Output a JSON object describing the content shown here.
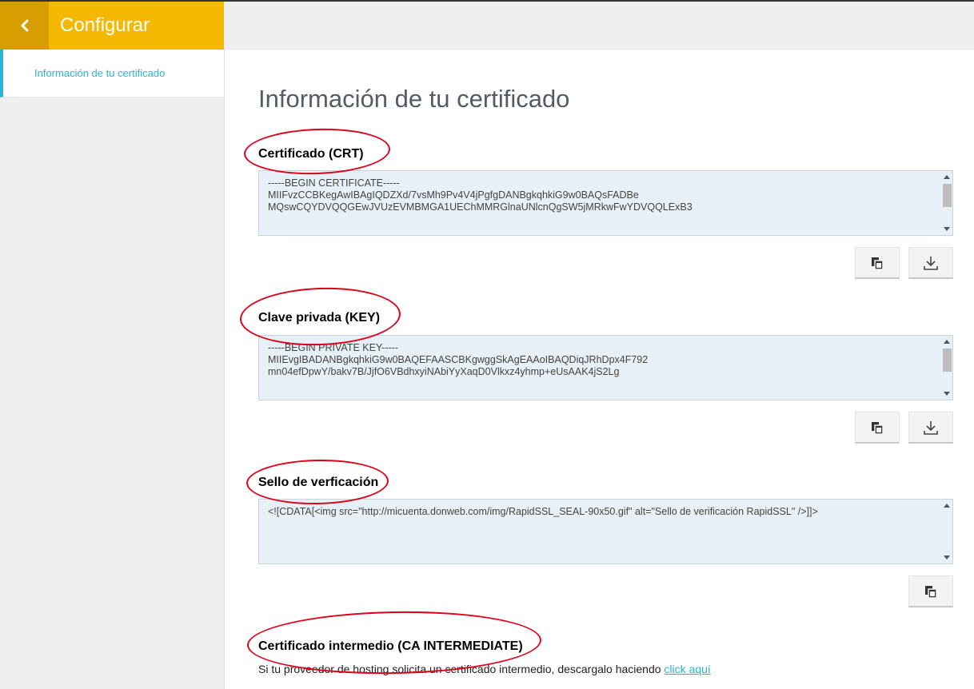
{
  "header": {
    "title": "Configurar",
    "back_icon": "chevron-left-icon"
  },
  "sidebar": {
    "items": [
      {
        "label": "Información de tu certificado",
        "active": true
      }
    ]
  },
  "page": {
    "title": "Información de tu certificado"
  },
  "sections": {
    "crt": {
      "heading": "Certificado (CRT)",
      "lines": [
        "-----BEGIN CERTIFICATE-----",
        "MIIFvzCCBKegAwIBAgIQDZXd/7vsMh9Pv4V4jPgfgDANBgkqhkiG9w0BAQsFADBe",
        "MQswCQYDVQQGEwJVUzEVMBMGA1UEChMMRGlnaUNlcnQgSW5jMRkwFwYDVQQLExB3"
      ],
      "buttons": [
        "copy-icon",
        "download-icon"
      ]
    },
    "key": {
      "heading": "Clave privada (KEY)",
      "lines": [
        "-----BEGIN PRIVATE KEY-----",
        "MIIEvgIBADANBgkqhkiG9w0BAQEFAASCBKgwggSkAgEAAoIBAQDiqJRhDpx4F792",
        "mn04efDpwY/bakv7B/JjfO6VBdhxyiNAbiYyXaqD0Vlkxz4yhmp+eUsAAK4jS2Lg"
      ],
      "buttons": [
        "copy-icon",
        "download-icon"
      ]
    },
    "seal": {
      "heading": "Sello de verficación",
      "lines": [
        "<![CDATA[<img src=\"http://micuenta.donweb.com/img/RapidSSL_SEAL-90x50.gif\" alt=\"Sello de verificación RapidSSL\" />]]>"
      ],
      "buttons": [
        "copy-icon"
      ]
    },
    "intermediate": {
      "heading": "Certificado intermedio (CA INTERMEDIATE)",
      "text": "Si tu proveedor de hosting solicita un certificado intermedio, descargalo haciendo",
      "link": "click aquí"
    }
  },
  "colors": {
    "header_back": "#d89e00",
    "header_title_bg": "#f5b800",
    "accent": "#2bb3d6",
    "annotation": "#e0001a",
    "code_bg": "#e7f0f6"
  }
}
